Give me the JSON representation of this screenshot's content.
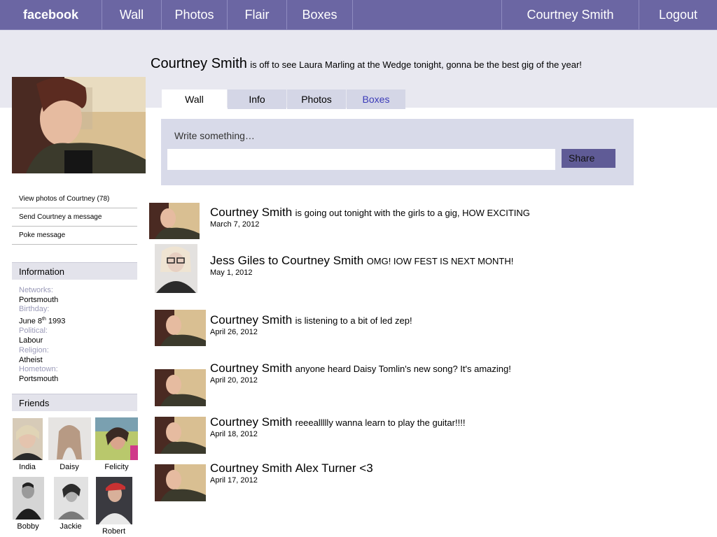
{
  "nav": {
    "logo": "facebook",
    "links": [
      "Wall",
      "Photos",
      "Flair",
      "Boxes"
    ],
    "user": "Courtney Smith",
    "logout": "Logout"
  },
  "profile": {
    "name": "Courtney Smith",
    "status": "is off to see Laura Marling at the Wedge tonight, gonna be the best gig of the year!"
  },
  "tabs": [
    "Wall",
    "Info",
    "Photos",
    "Boxes"
  ],
  "composer": {
    "prompt": "Write something…",
    "share": "Share"
  },
  "actions": [
    "View photos of Courtney (78)",
    "Send Courtney a message",
    "Poke message"
  ],
  "information": {
    "heading": "Information",
    "fields": [
      {
        "label": "Networks:",
        "value": "Portsmouth"
      },
      {
        "label": "Birthday:",
        "value_day": "June 8",
        "value_sup": "th",
        "value_year": " 1993"
      },
      {
        "label": "Political:",
        "value": "Labour"
      },
      {
        "label": "Religion:",
        "value": "Atheist"
      },
      {
        "label": "Hometown:",
        "value": "Portsmouth"
      }
    ]
  },
  "friends": {
    "heading": "Friends",
    "list": [
      "India",
      "Daisy",
      "Felicity",
      "Bobby",
      "Jackie",
      "Robert"
    ]
  },
  "posts": [
    {
      "author": "Courtney Smith",
      "message": "is going out tonight with the girls to a gig, HOW EXCITING",
      "date": "March 7, 2012"
    },
    {
      "author": "Jess Giles to Courtney Smith",
      "message": "OMG! IOW FEST IS NEXT MONTH!",
      "date": "May 1, 2012"
    },
    {
      "author": "Courtney Smith",
      "message": "is listening to a bit of led zep!",
      "date": "April 26, 2012"
    },
    {
      "author": "Courtney Smith",
      "message": "anyone heard Daisy Tomlin's new song? It's amazing!",
      "date": "April 20, 2012"
    },
    {
      "author": "Courtney Smith",
      "message": "reeeallllly wanna learn to play the guitar!!!!",
      "date": "April 18, 2012"
    },
    {
      "author": "Courtney Smith",
      "message": "Alex Turner <3",
      "date": "April 17, 2012"
    }
  ],
  "colors": {
    "nav": "#6b66a3",
    "band": "#e8e8f0",
    "tab": "#d4d6e6",
    "composer": "#d8dae9",
    "share": "#5f5b96",
    "link": "#3b3bb8",
    "label": "#9a9ab8"
  }
}
